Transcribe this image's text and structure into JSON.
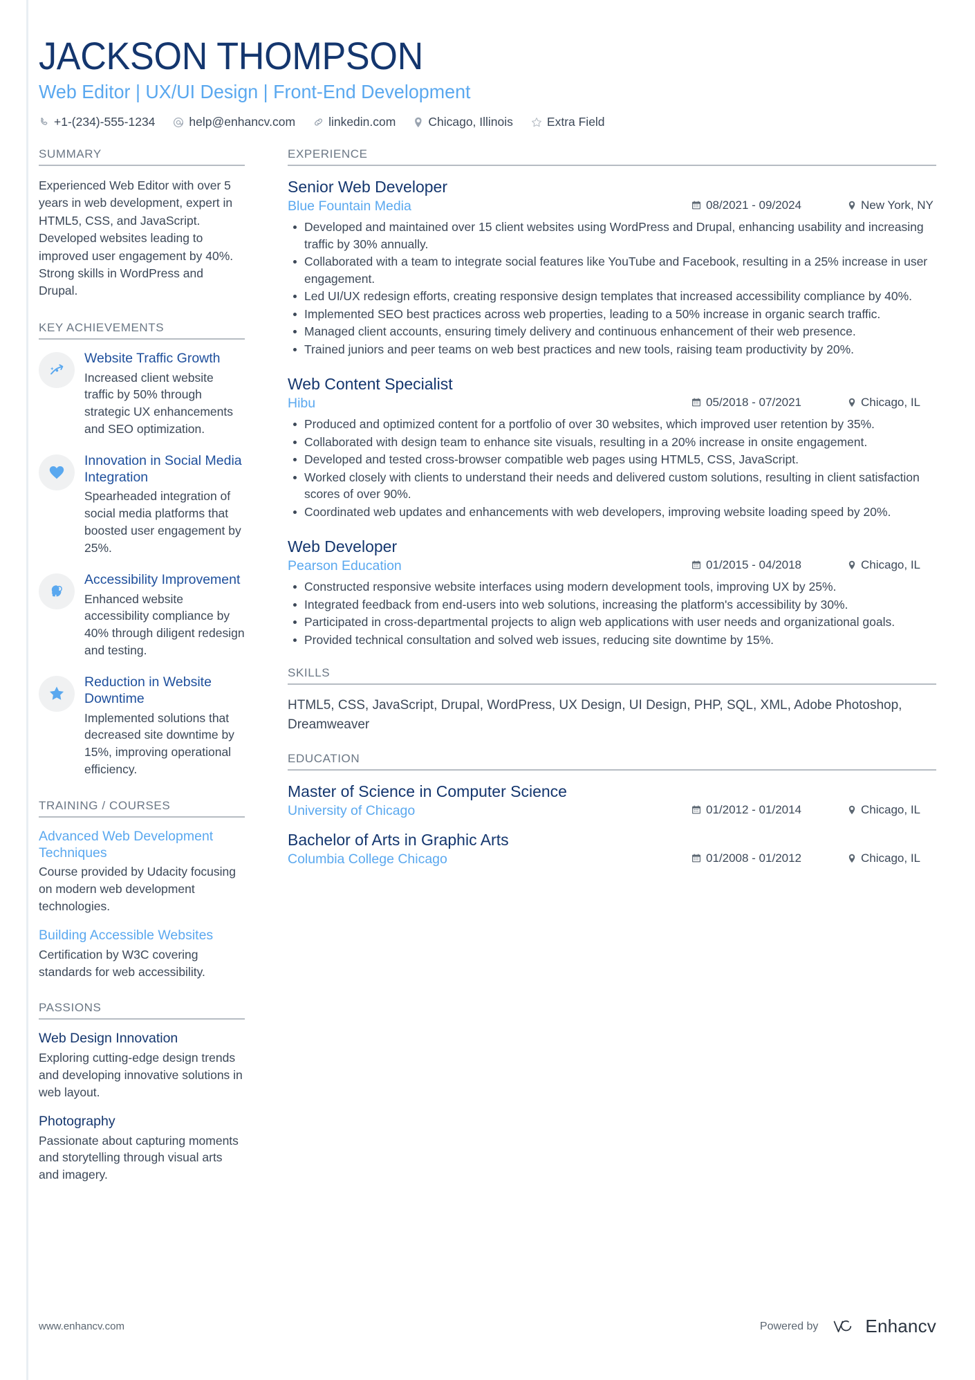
{
  "header": {
    "name": "JACKSON THOMPSON",
    "headline": "Web Editor | UX/UI Design | Front-End Development",
    "contacts": [
      {
        "icon": "phone-icon",
        "text": "+1-(234)-555-1234"
      },
      {
        "icon": "email-icon",
        "text": "help@enhancv.com"
      },
      {
        "icon": "link-icon",
        "text": "linkedin.com"
      },
      {
        "icon": "location-icon",
        "text": "Chicago, Illinois"
      },
      {
        "icon": "star-outline-icon",
        "text": "Extra Field"
      }
    ]
  },
  "sidebar": {
    "summary": {
      "title": "SUMMARY",
      "text": "Experienced Web Editor with over 5 years in web development, expert in HTML5, CSS, and JavaScript. Developed websites leading to improved user engagement by 40%. Strong skills in WordPress and Drupal."
    },
    "key_achievements": {
      "title": "KEY ACHIEVEMENTS",
      "items": [
        {
          "icon": "trend-arrow-icon",
          "title": "Website Traffic Growth",
          "desc": "Increased client website traffic by 50% through strategic UX enhancements and SEO optimization."
        },
        {
          "icon": "heart-icon",
          "title": "Innovation in Social Media Integration",
          "desc": "Spearheaded integration of social media platforms that boosted user engagement by 25%."
        },
        {
          "icon": "head-idea-icon",
          "title": "Accessibility Improvement",
          "desc": "Enhanced website accessibility compliance by 40% through diligent redesign and testing."
        },
        {
          "icon": "star-icon",
          "title": "Reduction in Website Downtime",
          "desc": "Implemented solutions that decreased site downtime by 15%, improving operational efficiency."
        }
      ]
    },
    "training": {
      "title": "TRAINING / COURSES",
      "items": [
        {
          "title": "Advanced Web Development Techniques",
          "desc": "Course provided by Udacity focusing on modern web development technologies."
        },
        {
          "title": "Building Accessible Websites",
          "desc": "Certification by W3C covering standards for web accessibility."
        }
      ]
    },
    "passions": {
      "title": "PASSIONS",
      "items": [
        {
          "title": "Web Design Innovation",
          "desc": "Exploring cutting-edge design trends and developing innovative solutions in web layout."
        },
        {
          "title": "Photography",
          "desc": "Passionate about capturing moments and storytelling through visual arts and imagery."
        }
      ]
    }
  },
  "main": {
    "experience": {
      "title": "EXPERIENCE",
      "jobs": [
        {
          "title": "Senior Web Developer",
          "company": "Blue Fountain Media",
          "dates": "08/2021 - 09/2024",
          "location": "New York, NY",
          "bullets": [
            "Developed and maintained over 15 client websites using WordPress and Drupal, enhancing usability and increasing traffic by 30% annually.",
            "Collaborated with a team to integrate social features like YouTube and Facebook, resulting in a 25% increase in user engagement.",
            "Led UI/UX redesign efforts, creating responsive design templates that increased accessibility compliance by 40%.",
            "Implemented SEO best practices across web properties, leading to a 50% increase in organic search traffic.",
            "Managed client accounts, ensuring timely delivery and continuous enhancement of their web presence.",
            "Trained juniors and peer teams on web best practices and new tools, raising team productivity by 20%."
          ]
        },
        {
          "title": "Web Content Specialist",
          "company": "Hibu",
          "dates": "05/2018 - 07/2021",
          "location": "Chicago, IL",
          "bullets": [
            "Produced and optimized content for a portfolio of over 30 websites, which improved user retention by 35%.",
            "Collaborated with design team to enhance site visuals, resulting in a 20% increase in onsite engagement.",
            "Developed and tested cross-browser compatible web pages using HTML5, CSS, JavaScript.",
            "Worked closely with clients to understand their needs and delivered custom solutions, resulting in client satisfaction scores of over 90%.",
            "Coordinated web updates and enhancements with web developers, improving website loading speed by 20%."
          ]
        },
        {
          "title": "Web Developer",
          "company": "Pearson Education",
          "dates": "01/2015 - 04/2018",
          "location": "Chicago, IL",
          "bullets": [
            "Constructed responsive website interfaces using modern development tools, improving UX by 25%.",
            "Integrated feedback from end-users into web solutions, increasing the platform's accessibility by 30%.",
            "Participated in cross-departmental projects to align web applications with user needs and organizational goals.",
            "Provided technical consultation and solved web issues, reducing site downtime by 15%."
          ]
        }
      ]
    },
    "skills": {
      "title": "SKILLS",
      "text": "HTML5, CSS, JavaScript, Drupal, WordPress, UX Design, UI Design, PHP, SQL, XML, Adobe Photoshop, Dreamweaver"
    },
    "education": {
      "title": "EDUCATION",
      "items": [
        {
          "degree": "Master of Science in Computer Science",
          "school": "University of Chicago",
          "dates": "01/2012 - 01/2014",
          "location": "Chicago, IL"
        },
        {
          "degree": "Bachelor of Arts in Graphic Arts",
          "school": "Columbia College Chicago",
          "dates": "01/2008 - 01/2012",
          "location": "Chicago, IL"
        }
      ]
    }
  },
  "footer": {
    "url": "www.enhancv.com",
    "powered_by": "Powered by",
    "brand": "Enhancv"
  },
  "colors": {
    "navy": "#14366e",
    "light_blue": "#5aa8ef",
    "mid_blue": "#1e4f9c",
    "body": "#3c4858",
    "muted": "#6b7785"
  }
}
